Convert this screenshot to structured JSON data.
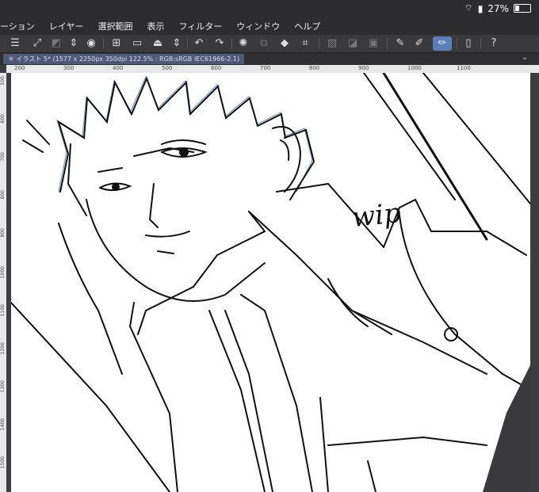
{
  "status_bar": {
    "battery": "27%"
  },
  "menu": [
    "ーション",
    "レイヤー",
    "選択範囲",
    "表示",
    "フィルター",
    "ウィンドウ",
    "ヘルプ"
  ],
  "document_tab": "＊ イラスト 5* (1577 x 2250px 350dpi 122.5% : RGB:sRGB IEC61966-2.1)",
  "ruler_h": [
    "200",
    "300",
    "400",
    "500",
    "600",
    "700",
    "800",
    "900",
    "1000",
    "1100"
  ],
  "ruler_v": [
    "500",
    "600",
    "700",
    "800",
    "900",
    "1000",
    "1100",
    "1200",
    "1300",
    "1400",
    "1500"
  ],
  "canvas_text": "wip"
}
